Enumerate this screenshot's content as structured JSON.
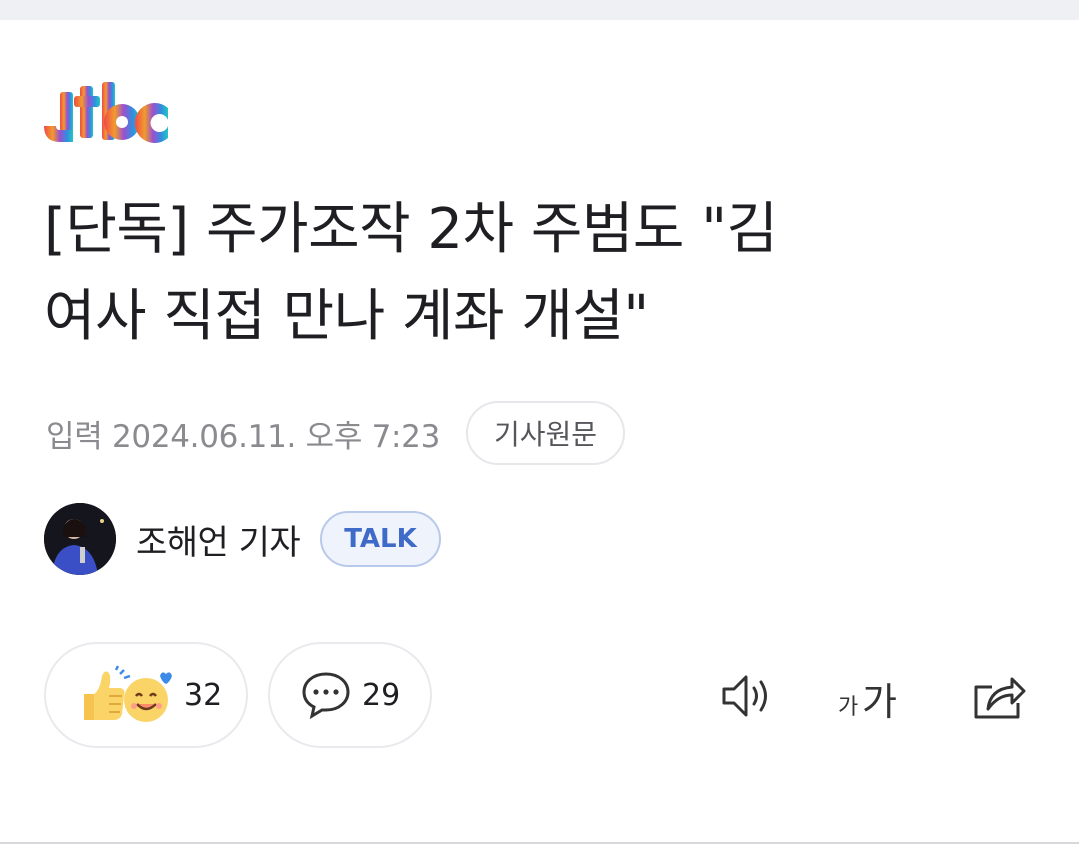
{
  "brand": {
    "logo_text": "jtbc"
  },
  "article": {
    "headline_line1": "[단독] 주가조작 2차 주범도 \"김",
    "headline_line2": "여사 직접 만나 계좌 개설\"",
    "published": "입력 2024.06.11. 오후 7:23",
    "original_article_label": "기사원문"
  },
  "reporter": {
    "name": "조해언 기자",
    "talk_label": "TALK"
  },
  "actions": {
    "reaction_count": "32",
    "comment_count": "29",
    "font_size_small": "가",
    "font_size_large": "가"
  },
  "icons": {
    "reaction": "thumbs-up-and-smile-emoji-icon",
    "comment": "speech-bubble-icon",
    "speaker": "speaker-icon",
    "share": "share-icon"
  }
}
